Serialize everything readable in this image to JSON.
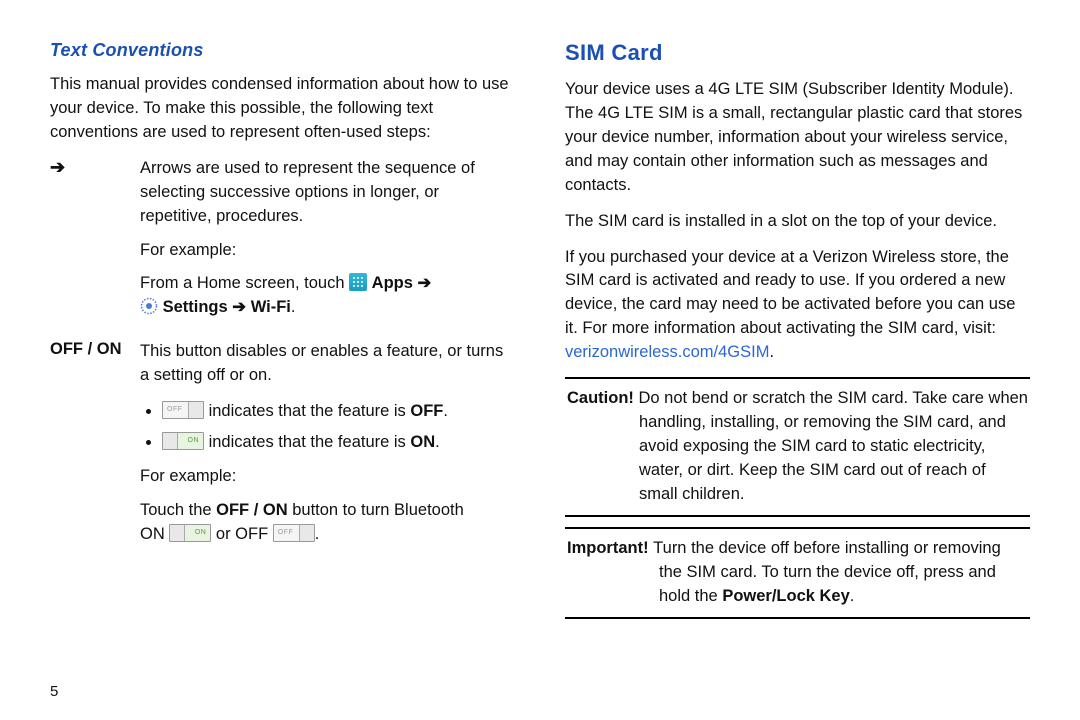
{
  "left": {
    "heading": "Text Conventions",
    "intro": "This manual provides condensed information about how to use your device. To make this possible, the following text conventions are used to represent often-used steps:",
    "arrow_label": "➔",
    "arrow_desc": "Arrows are used to represent the sequence of selecting successive options in longer, or repetitive, procedures.",
    "for_example": "For example:",
    "arrow_example_prefix": "From a Home screen, touch ",
    "apps_label": "Apps",
    "arrow_glyph": "➔",
    "settings_label": "Settings",
    "wifi_label": "Wi-Fi",
    "offon_label": "OFF / ON",
    "offon_desc": "This button disables or enables a feature, or turns a setting off or on.",
    "bullet_off_prefix": " indicates that the feature is ",
    "bullet_off_word": "OFF",
    "bullet_on_prefix": " indicates that the feature is ",
    "bullet_on_word": "ON",
    "offon_example1_prefix": "Touch the ",
    "offon_example1_mid": " button to turn Bluetooth ",
    "on_word": "ON ",
    "or_word": " or OFF ",
    "period": "."
  },
  "right": {
    "heading": "SIM Card",
    "p1": "Your device uses a 4G LTE SIM (Subscriber Identity Module). The 4G LTE SIM is a small, rectangular plastic card that stores your device number, information about your wireless service, and may contain other information such as messages and contacts.",
    "p2": "The SIM card is installed in a slot on the top of your device.",
    "p3_a": "If you purchased your device at a Verizon Wireless store, the SIM card is activated and ready to use. If you ordered a new device, the card may need to be activated before you can use it. For more information about activating the SIM card, visit: ",
    "p3_link": "verizonwireless.com/4GSIM",
    "caution_label": "Caution! ",
    "caution_first": "Do not bend or scratch the SIM card. Take care when",
    "caution_rest": "handling, installing, or removing the SIM card, and avoid exposing the SIM card to static electricity, water, or dirt. Keep the SIM card out of reach of small children.",
    "important_label": "Important! ",
    "important_first": "Turn the device off before installing or removing",
    "important_rest_a": "the SIM card. To turn the device off, press and hold the ",
    "important_rest_b": "Power/Lock Key",
    "important_rest_c": "."
  },
  "page_number": "5"
}
